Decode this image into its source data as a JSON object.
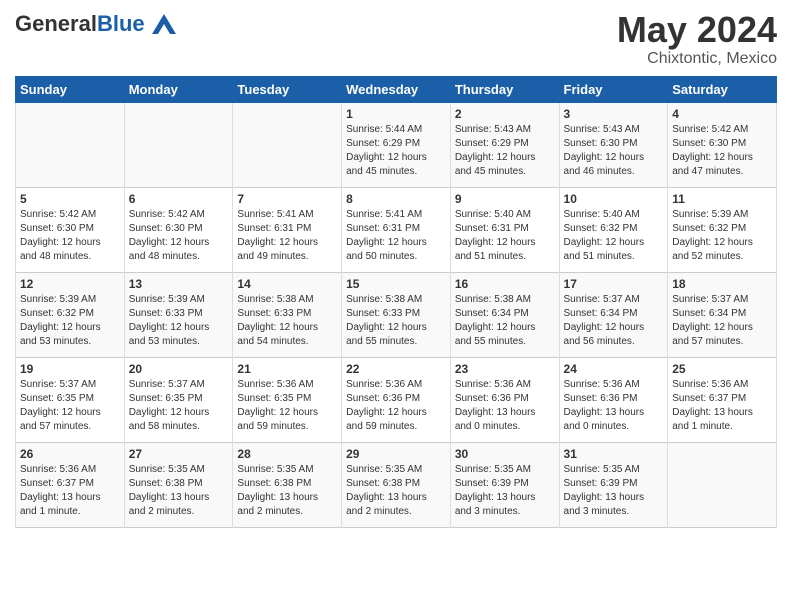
{
  "header": {
    "logo_general": "General",
    "logo_blue": "Blue",
    "month": "May 2024",
    "location": "Chixtontic, Mexico"
  },
  "weekdays": [
    "Sunday",
    "Monday",
    "Tuesday",
    "Wednesday",
    "Thursday",
    "Friday",
    "Saturday"
  ],
  "weeks": [
    [
      {
        "day": "",
        "info": ""
      },
      {
        "day": "",
        "info": ""
      },
      {
        "day": "",
        "info": ""
      },
      {
        "day": "1",
        "info": "Sunrise: 5:44 AM\nSunset: 6:29 PM\nDaylight: 12 hours\nand 45 minutes."
      },
      {
        "day": "2",
        "info": "Sunrise: 5:43 AM\nSunset: 6:29 PM\nDaylight: 12 hours\nand 45 minutes."
      },
      {
        "day": "3",
        "info": "Sunrise: 5:43 AM\nSunset: 6:30 PM\nDaylight: 12 hours\nand 46 minutes."
      },
      {
        "day": "4",
        "info": "Sunrise: 5:42 AM\nSunset: 6:30 PM\nDaylight: 12 hours\nand 47 minutes."
      }
    ],
    [
      {
        "day": "5",
        "info": "Sunrise: 5:42 AM\nSunset: 6:30 PM\nDaylight: 12 hours\nand 48 minutes."
      },
      {
        "day": "6",
        "info": "Sunrise: 5:42 AM\nSunset: 6:30 PM\nDaylight: 12 hours\nand 48 minutes."
      },
      {
        "day": "7",
        "info": "Sunrise: 5:41 AM\nSunset: 6:31 PM\nDaylight: 12 hours\nand 49 minutes."
      },
      {
        "day": "8",
        "info": "Sunrise: 5:41 AM\nSunset: 6:31 PM\nDaylight: 12 hours\nand 50 minutes."
      },
      {
        "day": "9",
        "info": "Sunrise: 5:40 AM\nSunset: 6:31 PM\nDaylight: 12 hours\nand 51 minutes."
      },
      {
        "day": "10",
        "info": "Sunrise: 5:40 AM\nSunset: 6:32 PM\nDaylight: 12 hours\nand 51 minutes."
      },
      {
        "day": "11",
        "info": "Sunrise: 5:39 AM\nSunset: 6:32 PM\nDaylight: 12 hours\nand 52 minutes."
      }
    ],
    [
      {
        "day": "12",
        "info": "Sunrise: 5:39 AM\nSunset: 6:32 PM\nDaylight: 12 hours\nand 53 minutes."
      },
      {
        "day": "13",
        "info": "Sunrise: 5:39 AM\nSunset: 6:33 PM\nDaylight: 12 hours\nand 53 minutes."
      },
      {
        "day": "14",
        "info": "Sunrise: 5:38 AM\nSunset: 6:33 PM\nDaylight: 12 hours\nand 54 minutes."
      },
      {
        "day": "15",
        "info": "Sunrise: 5:38 AM\nSunset: 6:33 PM\nDaylight: 12 hours\nand 55 minutes."
      },
      {
        "day": "16",
        "info": "Sunrise: 5:38 AM\nSunset: 6:34 PM\nDaylight: 12 hours\nand 55 minutes."
      },
      {
        "day": "17",
        "info": "Sunrise: 5:37 AM\nSunset: 6:34 PM\nDaylight: 12 hours\nand 56 minutes."
      },
      {
        "day": "18",
        "info": "Sunrise: 5:37 AM\nSunset: 6:34 PM\nDaylight: 12 hours\nand 57 minutes."
      }
    ],
    [
      {
        "day": "19",
        "info": "Sunrise: 5:37 AM\nSunset: 6:35 PM\nDaylight: 12 hours\nand 57 minutes."
      },
      {
        "day": "20",
        "info": "Sunrise: 5:37 AM\nSunset: 6:35 PM\nDaylight: 12 hours\nand 58 minutes."
      },
      {
        "day": "21",
        "info": "Sunrise: 5:36 AM\nSunset: 6:35 PM\nDaylight: 12 hours\nand 59 minutes."
      },
      {
        "day": "22",
        "info": "Sunrise: 5:36 AM\nSunset: 6:36 PM\nDaylight: 12 hours\nand 59 minutes."
      },
      {
        "day": "23",
        "info": "Sunrise: 5:36 AM\nSunset: 6:36 PM\nDaylight: 13 hours\nand 0 minutes."
      },
      {
        "day": "24",
        "info": "Sunrise: 5:36 AM\nSunset: 6:36 PM\nDaylight: 13 hours\nand 0 minutes."
      },
      {
        "day": "25",
        "info": "Sunrise: 5:36 AM\nSunset: 6:37 PM\nDaylight: 13 hours\nand 1 minute."
      }
    ],
    [
      {
        "day": "26",
        "info": "Sunrise: 5:36 AM\nSunset: 6:37 PM\nDaylight: 13 hours\nand 1 minute."
      },
      {
        "day": "27",
        "info": "Sunrise: 5:35 AM\nSunset: 6:38 PM\nDaylight: 13 hours\nand 2 minutes."
      },
      {
        "day": "28",
        "info": "Sunrise: 5:35 AM\nSunset: 6:38 PM\nDaylight: 13 hours\nand 2 minutes."
      },
      {
        "day": "29",
        "info": "Sunrise: 5:35 AM\nSunset: 6:38 PM\nDaylight: 13 hours\nand 2 minutes."
      },
      {
        "day": "30",
        "info": "Sunrise: 5:35 AM\nSunset: 6:39 PM\nDaylight: 13 hours\nand 3 minutes."
      },
      {
        "day": "31",
        "info": "Sunrise: 5:35 AM\nSunset: 6:39 PM\nDaylight: 13 hours\nand 3 minutes."
      },
      {
        "day": "",
        "info": ""
      }
    ]
  ]
}
